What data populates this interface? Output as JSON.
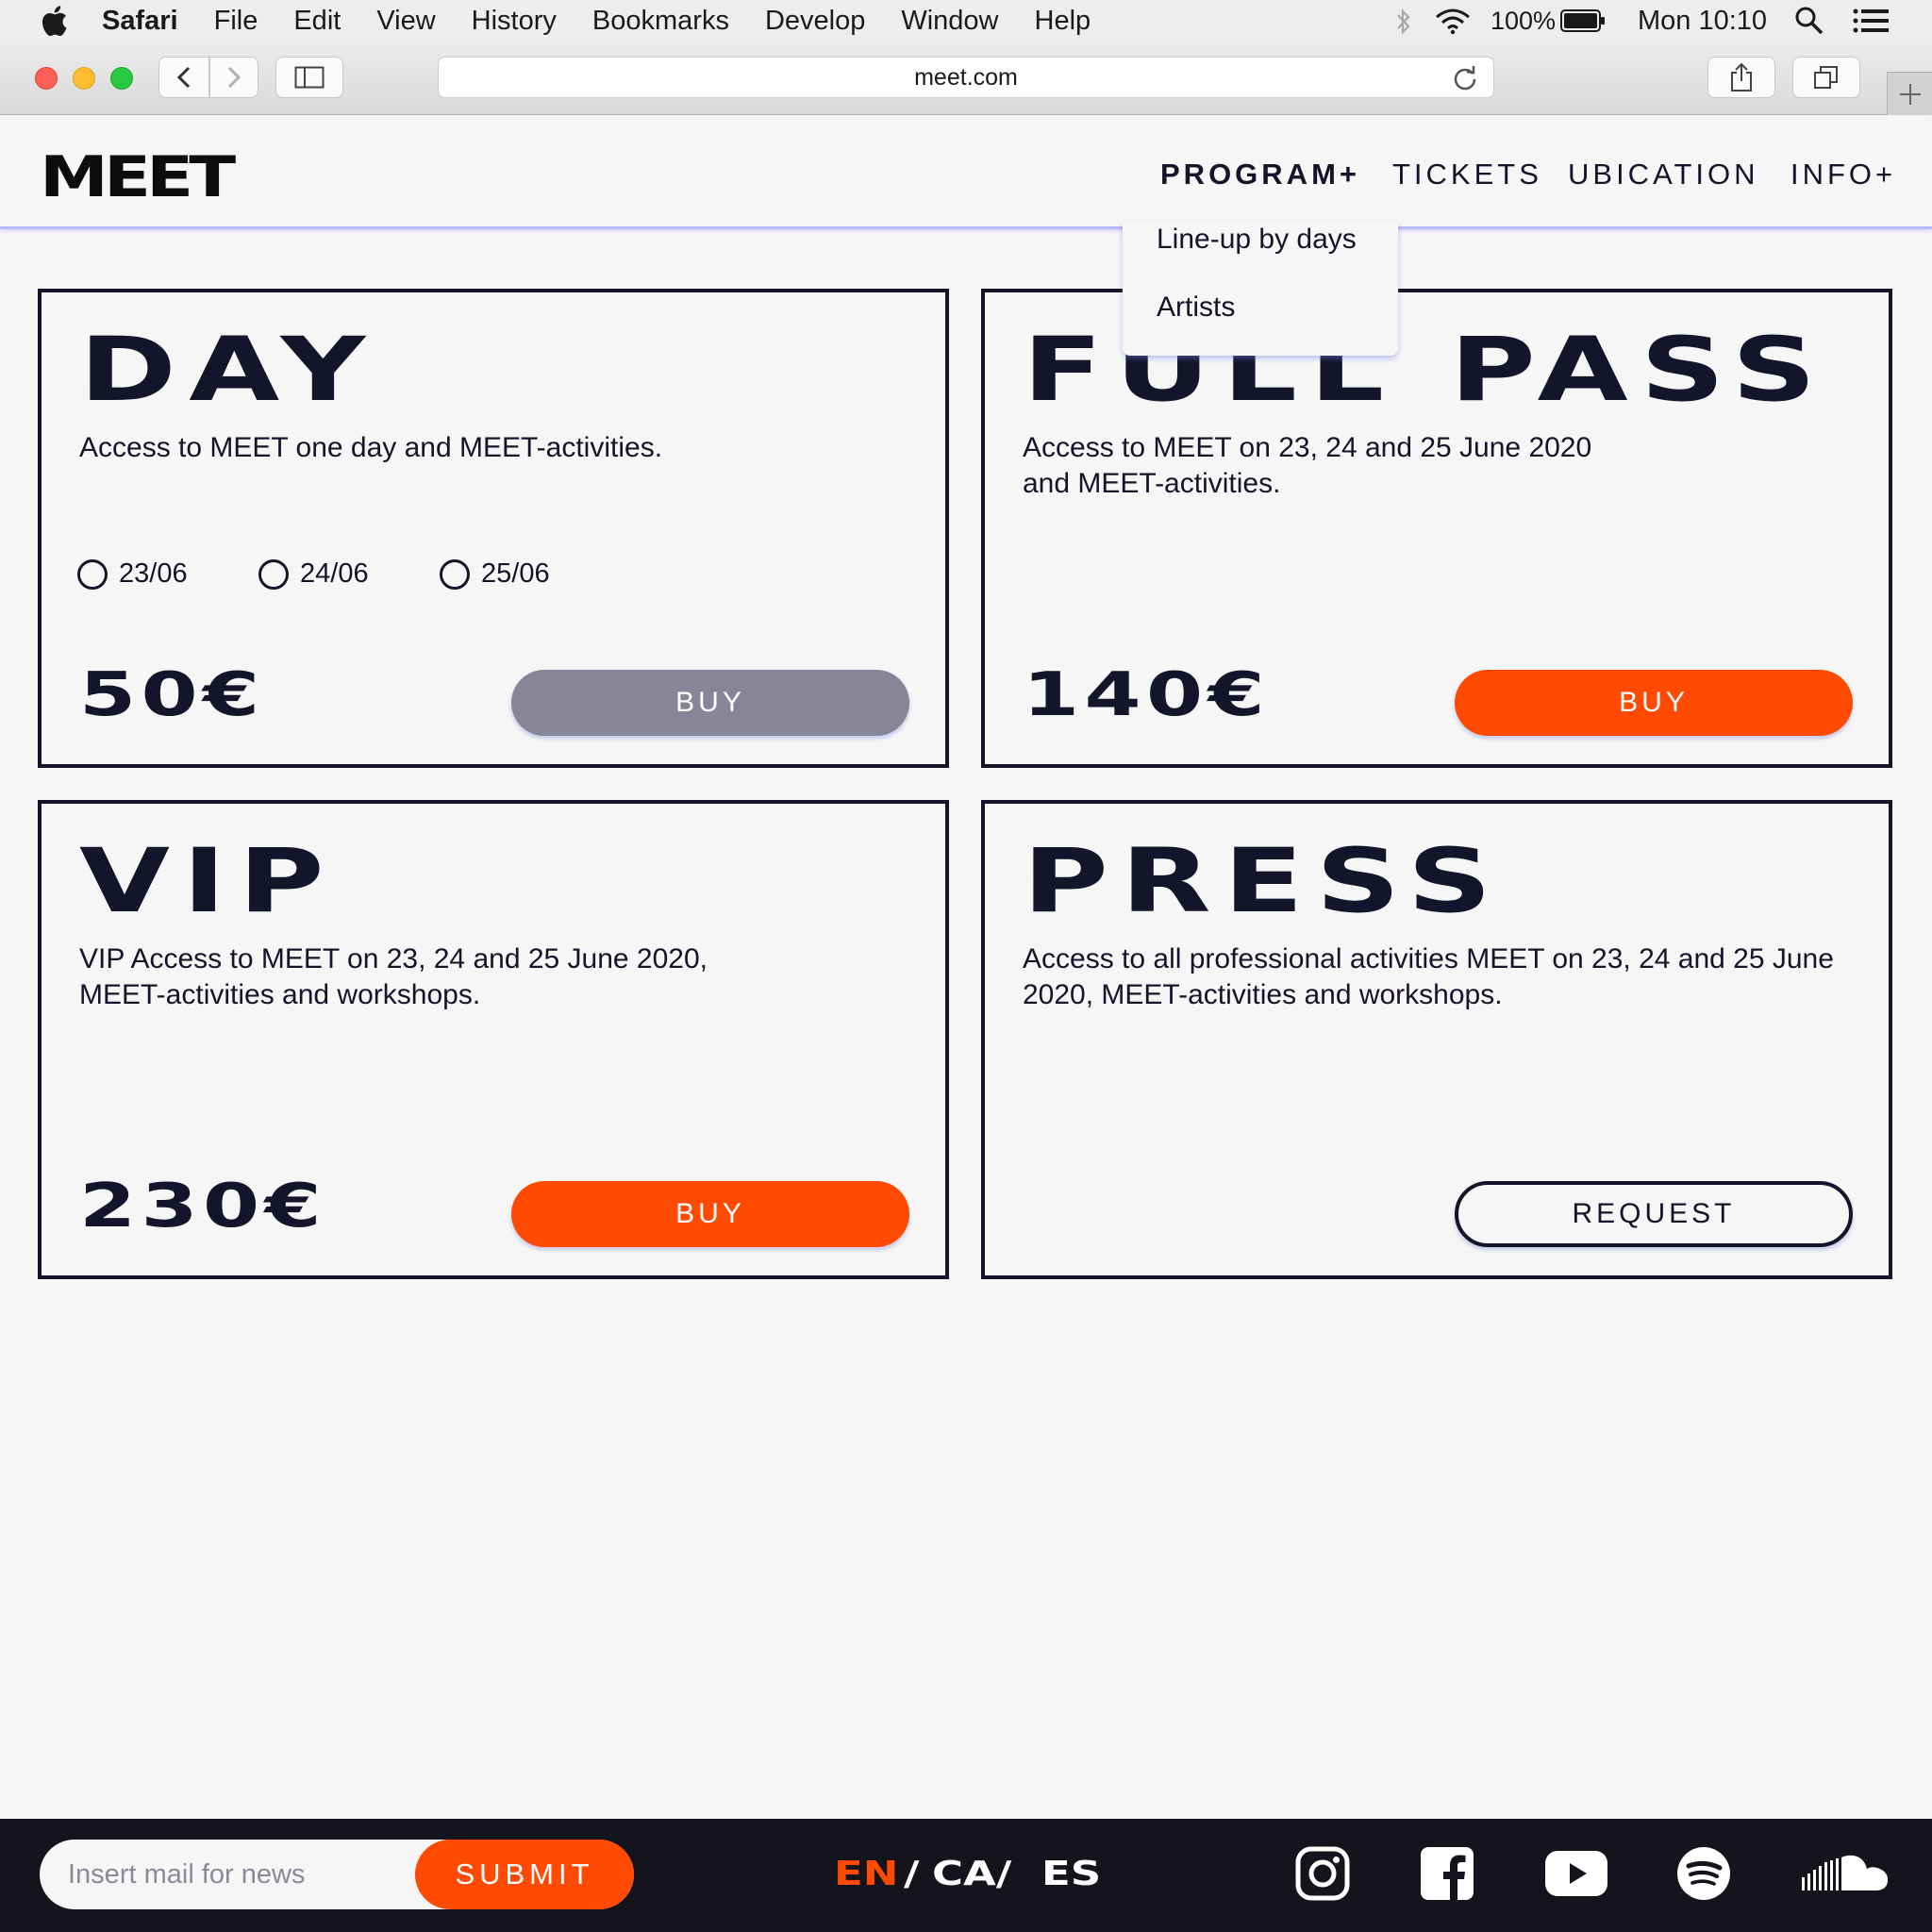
{
  "menubar": {
    "app_name": "Safari",
    "items": [
      "File",
      "Edit",
      "View",
      "History",
      "Bookmarks",
      "Develop",
      "Window",
      "Help"
    ],
    "battery": "100%",
    "clock": "Mon 10:10"
  },
  "browser": {
    "url": "meet.com"
  },
  "site": {
    "logo": "MEET",
    "nav": {
      "program": "PROGRAM+",
      "tickets": "TICKETS",
      "ubication": "UBICATION",
      "info": "INFO+"
    },
    "dropdown": [
      "Line-up by days",
      "Artists"
    ]
  },
  "tickets": {
    "day": {
      "title": "DAY",
      "description": "Access to MEET one day and MEET-activities.",
      "dates": [
        "23/06",
        "24/06",
        "25/06"
      ],
      "price": "50€",
      "button": "BUY"
    },
    "full_pass": {
      "title": "FULL PASS",
      "description": "Access to MEET on 23, 24 and 25 June 2020 and MEET-activities.",
      "price": "140€",
      "button": "BUY"
    },
    "vip": {
      "title": "VIP",
      "description": "VIP Access to MEET on 23, 24 and 25 June 2020, MEET-activities and workshops.",
      "price": "230€",
      "button": "BUY"
    },
    "press": {
      "title": "PRESS",
      "description": "Access to all professional activities MEET on 23, 24 and 25 June 2020, MEET-activities and workshops.",
      "button": "REQUEST"
    }
  },
  "footer": {
    "newsletter_placeholder": "Insert mail for news",
    "newsletter_value": "",
    "submit": "SUBMIT",
    "languages": {
      "en": "EN",
      "ca": "CA/",
      "es": "ES",
      "sep": "/"
    }
  },
  "colors": {
    "accent": "#fe4a03",
    "ink": "#14142a",
    "disabled_button": "#868698",
    "footer_bg": "#14141c",
    "header_shadow": "#b8b8f8"
  }
}
